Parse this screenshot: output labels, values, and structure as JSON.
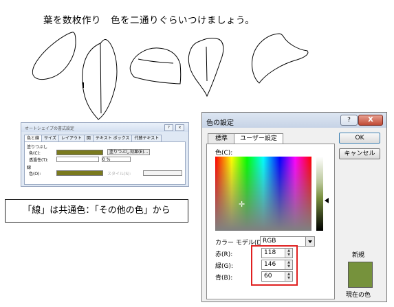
{
  "instruction": "葉を数枚作り　色を二通りぐらいつけましょう。",
  "callout": "「線」は共通色：「その他の色」から",
  "format_dialog": {
    "title": "オートシェイプの書式設定",
    "tabs": [
      "色と線",
      "サイズ",
      "レイアウト",
      "図",
      "テキスト ボックス",
      "代替テキスト"
    ],
    "fill_group": "塗りつぶし",
    "color_label": "色(C):",
    "effect_button": "塗りつぶし効果(E)...",
    "transparency_label": "透過性(T):",
    "transparency_value": "0 %",
    "line_group": "線",
    "line_color_label": "色(O):",
    "style_label": "スタイル(S):",
    "help_glyph": "?",
    "close_glyph": "×",
    "colors": {
      "fill": "#7a7a1e",
      "line": "#7a7a1e"
    }
  },
  "color_dialog": {
    "title": "色の設定",
    "help_glyph": "?",
    "close_glyph": "X",
    "tabs": [
      "標準",
      "ユーザー設定"
    ],
    "active_tab": "ユーザー設定",
    "colors_label": "色(C):",
    "model_label": "カラー モデル(D):",
    "model_value": "RGB",
    "red_label": "赤(R):",
    "red_value": "118",
    "green_label": "緑(G):",
    "green_value": "146",
    "blue_label": "青(B):",
    "blue_value": "60",
    "ok_label": "OK",
    "cancel_label": "キャンセル",
    "new_label": "新規",
    "current_label": "現在の色",
    "preview_color": "#76923c"
  }
}
